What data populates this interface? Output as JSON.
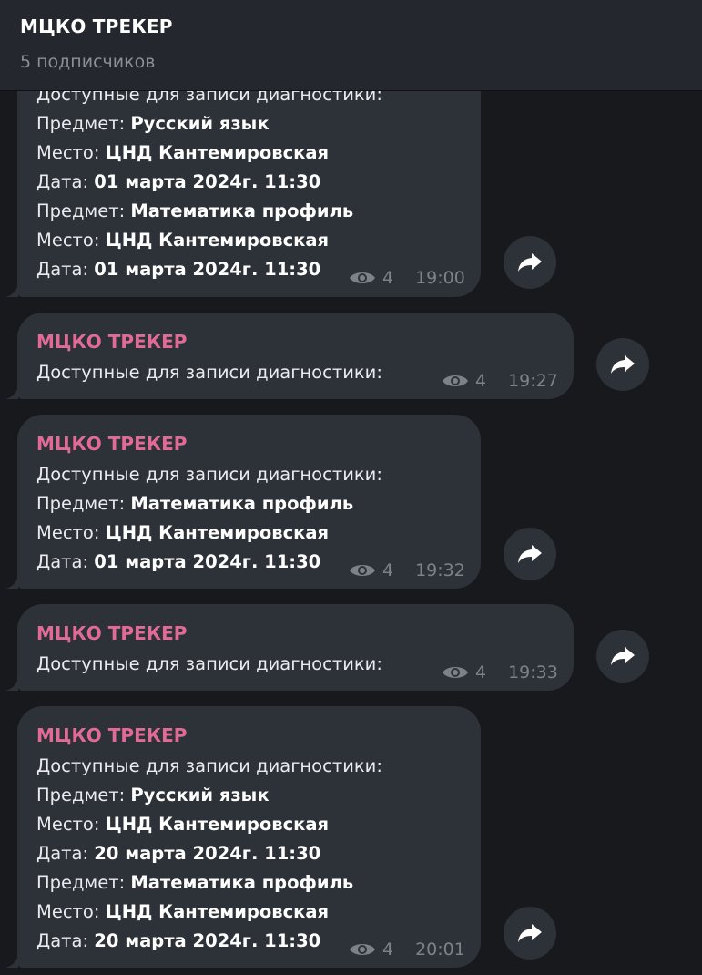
{
  "header": {
    "title": "МЦКО ТРЕКЕР",
    "subtitle": "5 подписчиков"
  },
  "messages": [
    {
      "lines": [
        {
          "k": "Доступные для записи диагностики:",
          "v": ""
        },
        {
          "k": "Предмет: ",
          "v": "Русский язык"
        },
        {
          "k": "Место: ",
          "v": "ЦНД Кантемировская"
        },
        {
          "k": "Дата: ",
          "v": "01 марта 2024г. 11:30"
        },
        {
          "k": "Предмет: ",
          "v": "Математика профиль"
        },
        {
          "k": "Место: ",
          "v": "ЦНД Кантемировская"
        },
        {
          "k": "Дата: ",
          "v": "01 марта 2024г. 11:30"
        }
      ],
      "views": "4",
      "time": "19:00"
    },
    {
      "author": "МЦКО ТРЕКЕР",
      "lines": [
        {
          "k": "Доступные для записи диагностики:",
          "v": ""
        }
      ],
      "views": "4",
      "time": "19:27"
    },
    {
      "author": "МЦКО ТРЕКЕР",
      "lines": [
        {
          "k": "Доступные для записи диагностики:",
          "v": ""
        },
        {
          "k": "Предмет: ",
          "v": "Математика профиль"
        },
        {
          "k": "Место: ",
          "v": "ЦНД Кантемировская"
        },
        {
          "k": "Дата: ",
          "v": "01 марта 2024г. 11:30"
        }
      ],
      "views": "4",
      "time": "19:32"
    },
    {
      "author": "МЦКО ТРЕКЕР",
      "lines": [
        {
          "k": "Доступные для записи диагностики:",
          "v": ""
        }
      ],
      "views": "4",
      "time": "19:33"
    },
    {
      "author": "МЦКО ТРЕКЕР",
      "lines": [
        {
          "k": "Доступные для записи диагностики:",
          "v": ""
        },
        {
          "k": "Предмет: ",
          "v": "Русский язык"
        },
        {
          "k": "Место: ",
          "v": "ЦНД Кантемировская"
        },
        {
          "k": "Дата: ",
          "v": "20 марта 2024г. 11:30"
        },
        {
          "k": "Предмет: ",
          "v": "Математика профиль"
        },
        {
          "k": "Место: ",
          "v": "ЦНД Кантемировская"
        },
        {
          "k": "Дата: ",
          "v": "20 марта 2024г. 11:30"
        }
      ],
      "views": "4",
      "time": "20:01"
    }
  ],
  "icons": {
    "views": "eye-icon",
    "share": "share-arrow-icon"
  },
  "colors": {
    "background": "#18191d",
    "bubble": "#2d3138",
    "header": "#24272d",
    "author": "#e16b96",
    "meta": "#7d828a"
  }
}
